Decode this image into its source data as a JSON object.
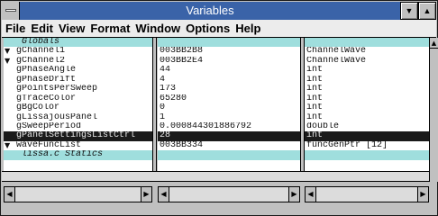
{
  "window": {
    "title": "Variables"
  },
  "menu": [
    "File",
    "Edit",
    "View",
    "Format",
    "Window",
    "Options",
    "Help"
  ],
  "rows": [
    {
      "name": "Globals",
      "value": "",
      "type": "",
      "kind": "header",
      "expander": ""
    },
    {
      "name": "gChannel1",
      "value": "003BB2B8",
      "type": "ChannelWave",
      "kind": "normal",
      "expander": "▼"
    },
    {
      "name": "gChannel2",
      "value": "003BB2E4",
      "type": "ChannelWave",
      "kind": "normal",
      "expander": "▼"
    },
    {
      "name": "gPhaseAngle",
      "value": "44",
      "type": "int",
      "kind": "normal",
      "expander": ""
    },
    {
      "name": "gPhaseDrift",
      "value": "4",
      "type": "int",
      "kind": "normal",
      "expander": ""
    },
    {
      "name": "gPointsPerSweep",
      "value": "173",
      "type": "int",
      "kind": "normal",
      "expander": ""
    },
    {
      "name": "gTraceColor",
      "value": "65280",
      "type": "int",
      "kind": "normal",
      "expander": ""
    },
    {
      "name": "gBgColor",
      "value": "0",
      "type": "int",
      "kind": "normal",
      "expander": ""
    },
    {
      "name": "gLissajousPanel",
      "value": "1",
      "type": "int",
      "kind": "normal",
      "expander": ""
    },
    {
      "name": "gSweepPeriod",
      "value": "0.000844301886792",
      "type": "double",
      "kind": "normal",
      "expander": ""
    },
    {
      "name": "gPanelSettingsListCtrl",
      "value": "28",
      "type": "int",
      "kind": "selected",
      "expander": ""
    },
    {
      "name": "waveFuncList",
      "value": "003BB334",
      "type": "funcGenPtr [12]",
      "kind": "normal",
      "expander": "▼"
    },
    {
      "name": "lissa.c Statics",
      "value": "",
      "type": "",
      "kind": "header",
      "expander": ""
    }
  ],
  "icons": {
    "system_menu": "system-menu-icon",
    "minimize": "minimize-icon",
    "maximize": "maximize-icon",
    "scroll_up": "scroll-up-arrow-icon",
    "scroll_left": "scroll-left-arrow-icon",
    "scroll_right": "scroll-right-arrow-icon",
    "expand": "expand-triangle-icon"
  },
  "colors": {
    "title_bar": "#3a63a8",
    "header_row": "#9fdedd",
    "selected_row": "#1a1a1a",
    "chrome": "#c0c0c0"
  }
}
